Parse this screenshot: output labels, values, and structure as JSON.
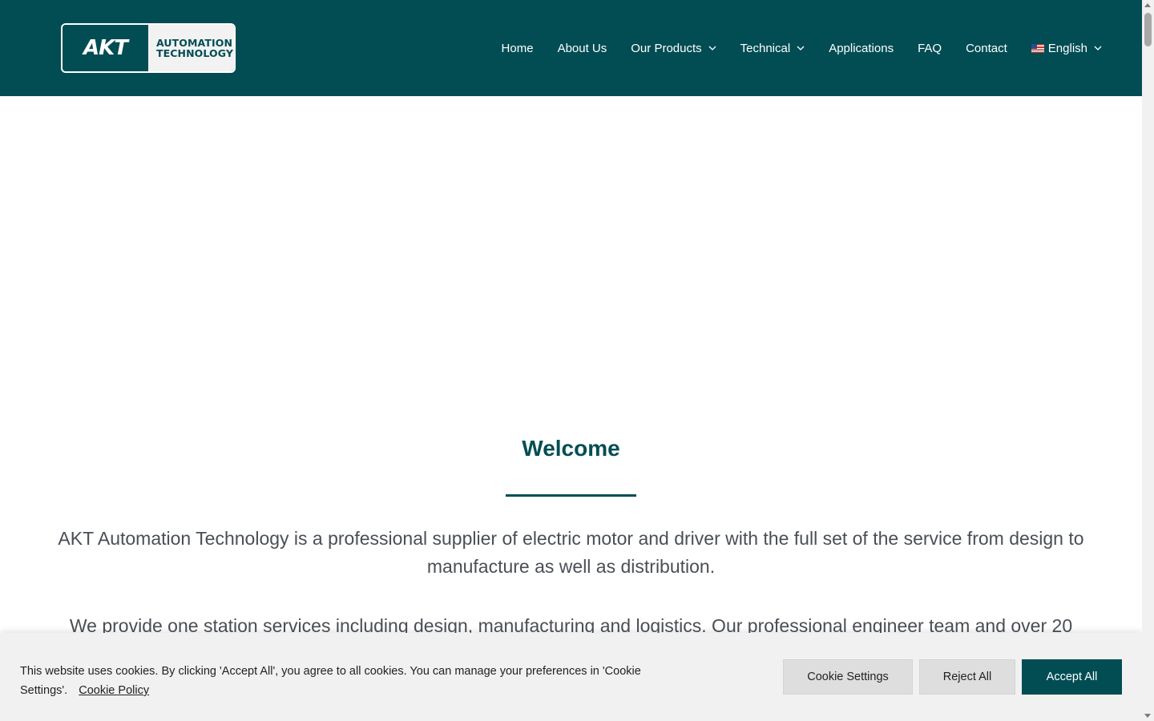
{
  "header": {
    "logo": {
      "mark": "AKT",
      "line1": "AUTOMATION",
      "line2": "TECHNOLOGY"
    },
    "nav": [
      {
        "label": "Home",
        "dropdown": false
      },
      {
        "label": "About Us",
        "dropdown": false
      },
      {
        "label": "Our Products",
        "dropdown": true
      },
      {
        "label": "Technical",
        "dropdown": true
      },
      {
        "label": "Applications",
        "dropdown": false
      },
      {
        "label": "FAQ",
        "dropdown": false
      },
      {
        "label": "Contact",
        "dropdown": false
      },
      {
        "label": "English",
        "dropdown": true,
        "icon": "us-flag-icon"
      }
    ]
  },
  "main": {
    "welcome_title": "Welcome",
    "paragraph1": "AKT Automation Technology is a professional supplier of electric motor and driver with the full set of the service from design to manufacture as well as distribution.",
    "paragraph2": "We provide one station services including design, manufacturing and logistics. Our professional engineer team and over 20"
  },
  "cookie_banner": {
    "text": "This website uses cookies. By clicking 'Accept All', you agree to all cookies. You can manage your preferences in 'Cookie Settings'.",
    "policy_link": "Cookie Policy",
    "settings_label": "Cookie Settings",
    "reject_label": "Reject All",
    "accept_label": "Accept All"
  },
  "colors": {
    "brand": "#024d54",
    "banner_bg": "#f1f1f1",
    "button_gray": "#dedede"
  }
}
